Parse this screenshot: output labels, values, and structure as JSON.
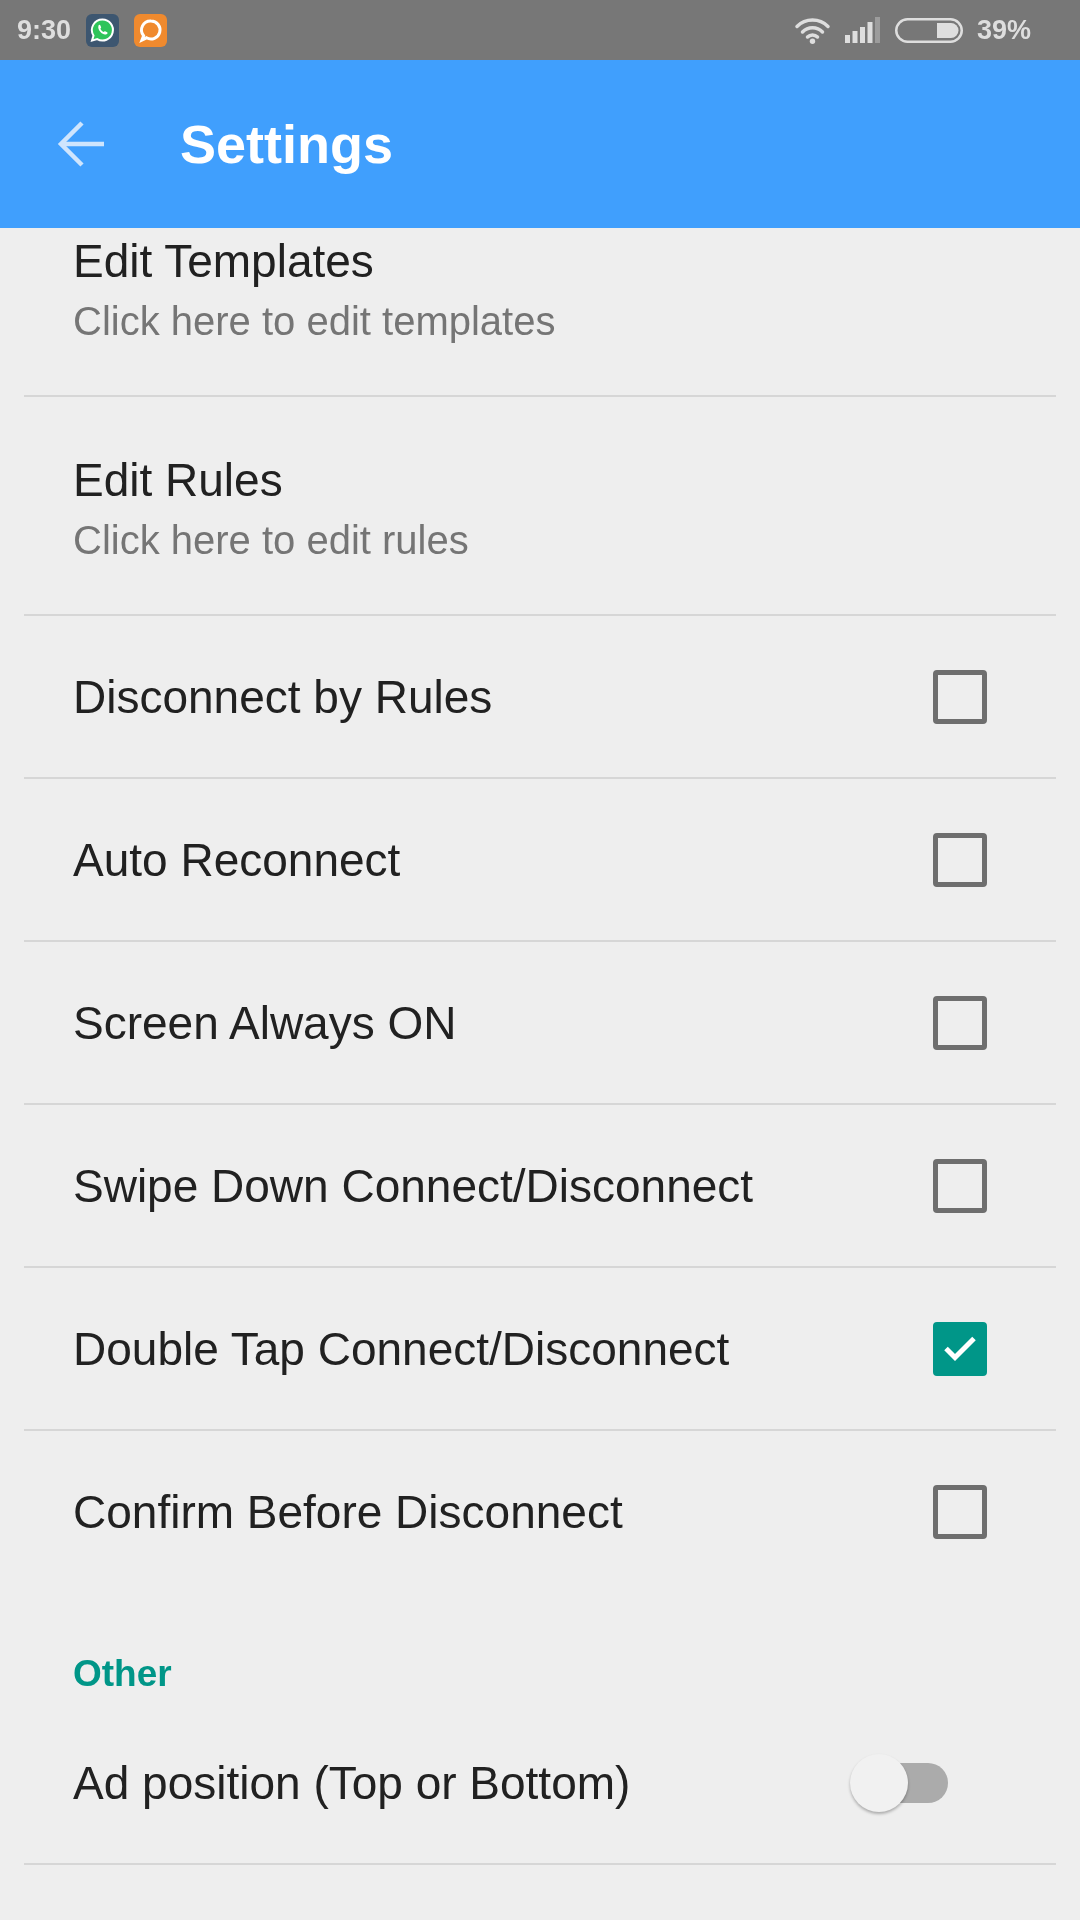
{
  "status_bar": {
    "time": "9:30",
    "battery": "39%"
  },
  "app_bar": {
    "title": "Settings"
  },
  "preferences": [
    {
      "kind": "link",
      "title": "Edit Templates",
      "summary": "Click here to edit templates"
    },
    {
      "kind": "link",
      "title": "Edit Rules",
      "summary": "Click here to edit rules"
    },
    {
      "kind": "checkbox",
      "title": "Disconnect by Rules",
      "checked": false
    },
    {
      "kind": "checkbox",
      "title": "Auto Reconnect",
      "checked": false
    },
    {
      "kind": "checkbox",
      "title": "Screen Always ON",
      "checked": false
    },
    {
      "kind": "checkbox",
      "title": "Swipe Down Connect/Disconnect",
      "checked": false
    },
    {
      "kind": "checkbox",
      "title": "Double Tap Connect/Disconnect",
      "checked": true
    },
    {
      "kind": "checkbox",
      "title": "Confirm Before Disconnect",
      "checked": false
    },
    {
      "kind": "category",
      "title": "Other"
    },
    {
      "kind": "switch",
      "title": "Ad position (Top or Bottom)",
      "on": false
    }
  ]
}
